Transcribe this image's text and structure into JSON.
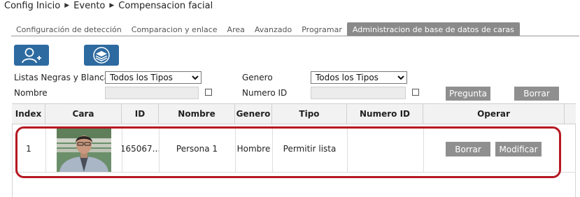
{
  "breadcrumb": [
    "Config Inicio",
    "Evento",
    "Compensacion facial"
  ],
  "tabs": [
    {
      "label": "Configuración de detección",
      "active": false
    },
    {
      "label": "Comparacion y enlace",
      "active": false
    },
    {
      "label": "Area",
      "active": false
    },
    {
      "label": "Avanzado",
      "active": false
    },
    {
      "label": "Programar",
      "active": false
    },
    {
      "label": "Administracion de base de datos de caras",
      "active": true
    }
  ],
  "toolbar": {
    "add_icon": "add-person-icon",
    "layers_icon": "layers-icon",
    "accent": "#2d6aa0"
  },
  "filters": {
    "list_label": "Listas Negras y Blancas",
    "list_value": "Todos los Tipos",
    "gender_label": "Genero",
    "gender_value": "Todos los Tipos",
    "name_label": "Nombre",
    "name_value": "",
    "id_label": "Numero ID",
    "id_value": "",
    "search_button": "Pregunta",
    "clear_button": "Borrar"
  },
  "table": {
    "headers": [
      "Index",
      "Cara",
      "ID",
      "Nombre",
      "Genero",
      "Tipo",
      "Numero ID",
      "Operar"
    ],
    "rows": [
      {
        "index": "1",
        "id": "165067...",
        "name": "Persona 1",
        "gender": "Hombre",
        "type": "Permitir lista",
        "number_id": "",
        "delete_label": "Borrar",
        "modify_label": "Modificar"
      }
    ]
  },
  "highlight_color": "#b51822"
}
